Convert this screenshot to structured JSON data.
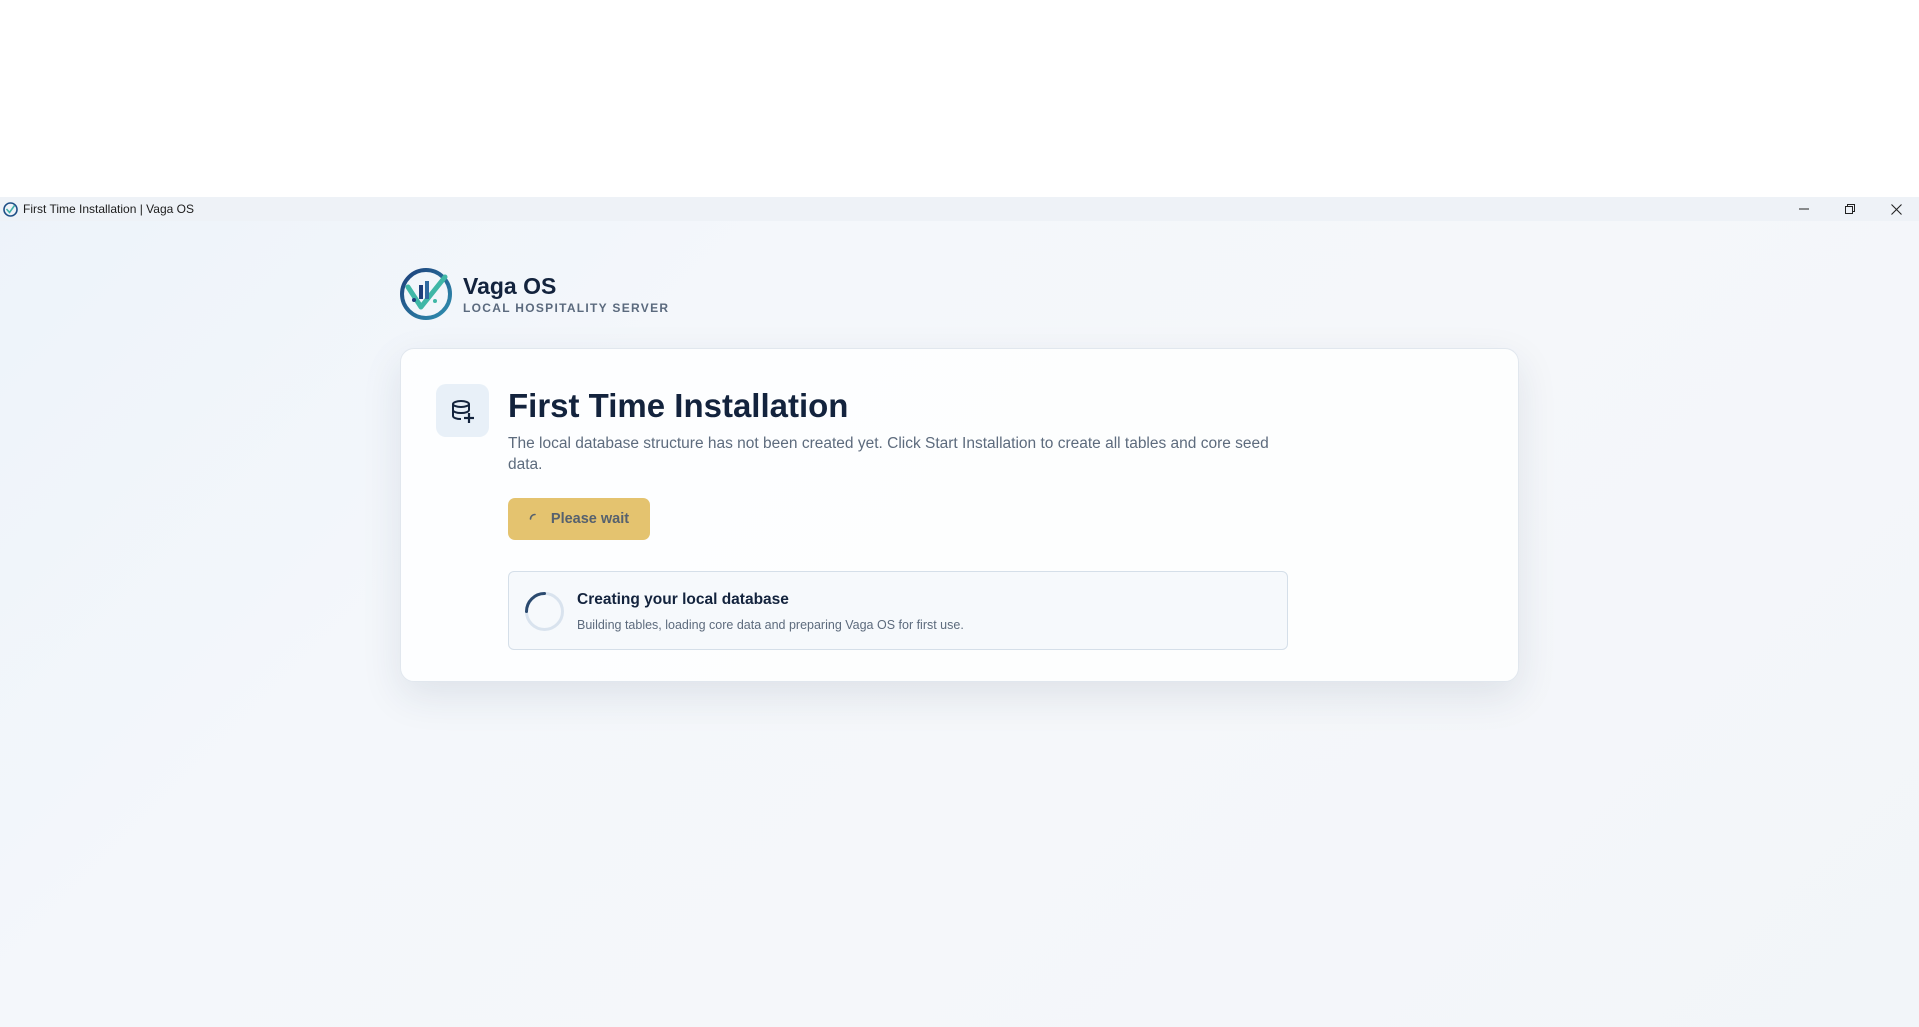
{
  "window": {
    "title": "First Time Installation | Vaga OS",
    "controls": {
      "minimize": "minimize-icon",
      "restore": "restore-icon",
      "close": "close-icon"
    }
  },
  "brand": {
    "name": "Vaga OS",
    "subtitle": "LOCAL HOSPITALITY SERVER"
  },
  "install": {
    "icon": "database-add-icon",
    "title": "First Time Installation",
    "description": "The local database structure has not been created yet. Click Start Installation to create all tables and core seed data.",
    "button_label": "Please wait",
    "status": {
      "title": "Creating your local database",
      "description": "Building tables, loading core data and preparing Vaga OS for first use."
    }
  },
  "colors": {
    "accent_button": "#e4c36f",
    "heading": "#13233d",
    "muted_text": "#5d6b7d",
    "spinner": "#2b4a6f"
  }
}
